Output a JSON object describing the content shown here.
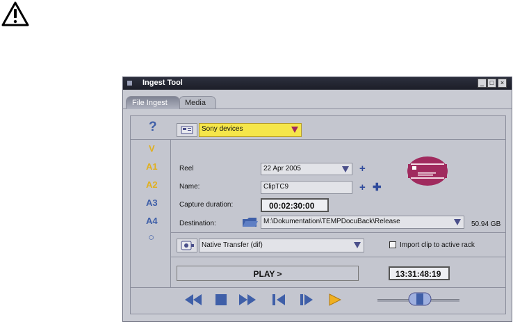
{
  "window": {
    "title": "Ingest Tool",
    "minimize_label": "_",
    "maximize_label": "□",
    "close_label": "×"
  },
  "tabs": [
    {
      "label": "File Ingest",
      "active": true
    },
    {
      "label": "Media",
      "active": false
    }
  ],
  "help": {
    "label": "?"
  },
  "device": {
    "selected": "Sony devices",
    "highlight": "#f5e64a"
  },
  "tracks": [
    {
      "label": "V",
      "color": "#e0b020"
    },
    {
      "label": "A1",
      "color": "#e0b020"
    },
    {
      "label": "A2",
      "color": "#e0b020"
    },
    {
      "label": "A3",
      "color": "#3f5fa8"
    },
    {
      "label": "A4",
      "color": "#3f5fa8"
    },
    {
      "label": "○",
      "color": "#3f5fa8"
    }
  ],
  "form": {
    "reel_label": "Reel",
    "reel_value": "22 Apr 2005",
    "name_label": "Name:",
    "name_value": "ClipTC9",
    "duration_label": "Capture duration:",
    "duration_value": "00:02:30:00",
    "destination_label": "Destination:",
    "destination_value": "M:\\Dokumentation\\TEMPDocuBack\\Release",
    "free_space": "50.94 GB"
  },
  "transfer": {
    "selected": "Native Transfer (dif)",
    "import_label": "Import clip to active rack",
    "import_checked": false
  },
  "play": {
    "label": "PLAY >"
  },
  "timecode": "13:31:48:19",
  "colors": {
    "accent": "#3f5fa8",
    "brand": "#a02a5e",
    "title_bar": "#22242f"
  }
}
